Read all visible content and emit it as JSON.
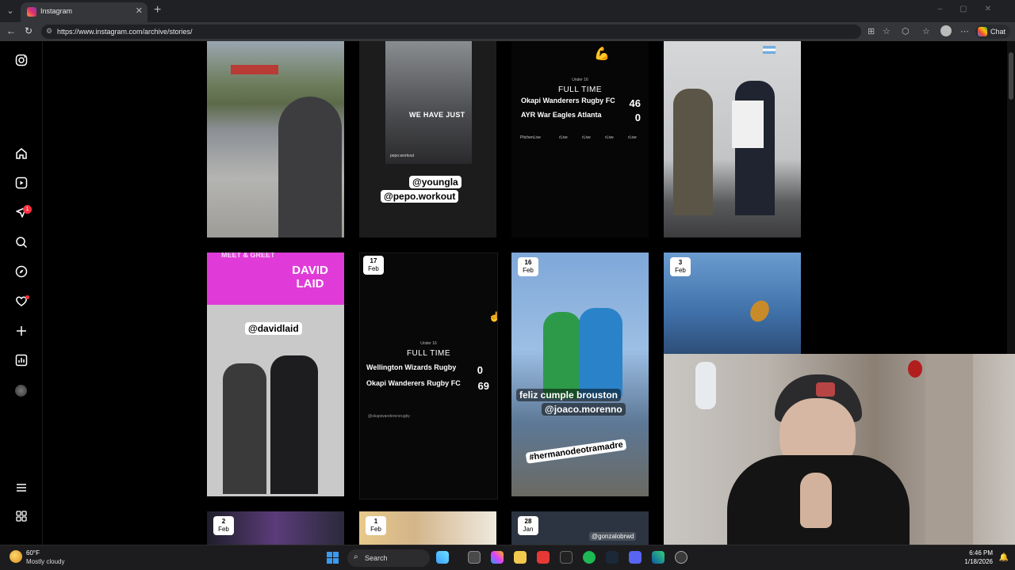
{
  "browser": {
    "tab_title": "Instagram",
    "url": "https://www.instagram.com/archive/stories/",
    "chat_label": "Chat"
  },
  "sidebar": {
    "notification_count": "1",
    "icons": [
      "instagram-logo-icon",
      "home-icon",
      "reels-icon",
      "messages-icon",
      "search-icon",
      "explore-icon",
      "notifications-icon",
      "create-icon",
      "dashboard-icon",
      "profile-avatar",
      "menu-icon",
      "also-from-meta-icon"
    ]
  },
  "stories": {
    "row1": {
      "tile2": {
        "caption": "WE HAVE JUST",
        "handle_small": "pepo.workout",
        "mention1": "@youngla",
        "mention2": "@pepo.workout"
      },
      "tile3": {
        "emoji": "💪",
        "under": "Under 16",
        "status": "FULL TIME",
        "team1": "Okapi Wanderers Rugby FC",
        "score1": "46",
        "team2": "AYR War Eagles Atlanta",
        "score2": "0",
        "streams": [
          "PitchenLive",
          "rLive",
          "rLive",
          "rLive",
          "rLive"
        ]
      }
    },
    "row2": {
      "tile1": {
        "banner_top": "MEET & GREET",
        "banner_name": "DAVID LAID",
        "mention": "@davidlaid"
      },
      "tile2": {
        "day": "17",
        "month": "Feb",
        "under": "Under 16",
        "status": "FULL TIME",
        "team1": "Wellington Wizards Rugby",
        "score1": "0",
        "team2": "Okapi Wanderers Rugby FC",
        "score2": "69",
        "handle": "@okapiwanderersrugby"
      },
      "tile3": {
        "day": "16",
        "month": "Feb",
        "caption1": "feliz cumple brouston",
        "caption2": "@joaco.morenno",
        "hashtag": "#hermanodeotramadre"
      },
      "tile4": {
        "day": "3",
        "month": "Feb"
      }
    },
    "row3": {
      "tile1": {
        "day": "2",
        "month": "Feb"
      },
      "tile2": {
        "day": "1",
        "month": "Feb"
      },
      "tile3": {
        "day": "28",
        "month": "Jan",
        "mention": "@gonzalobrwd"
      }
    }
  },
  "taskbar": {
    "temperature": "60°F",
    "weather": "Mostly cloudy",
    "search_label": "Search",
    "time": "6:46 PM",
    "date": "1/18/2026"
  }
}
